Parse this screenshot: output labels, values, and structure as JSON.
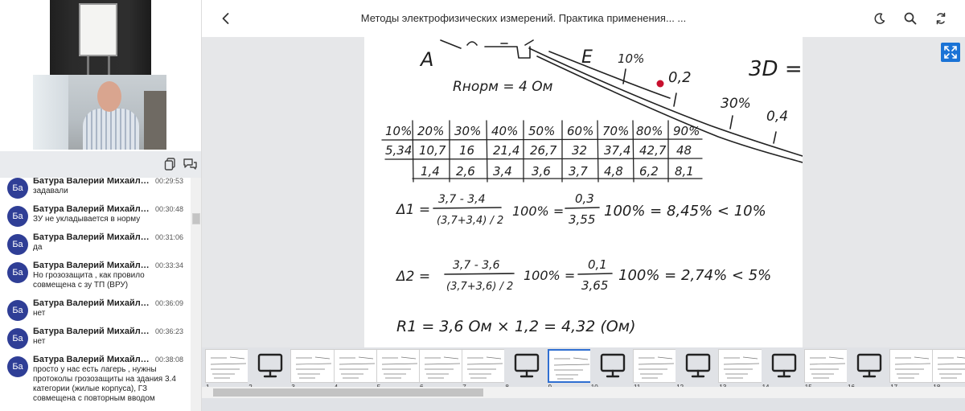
{
  "header": {
    "title": "Методы электрофизических измерений. Практика применения... ..."
  },
  "video": {
    "feeds": [
      "presenter-board",
      "presenter-camera"
    ]
  },
  "chat": {
    "messages": [
      {
        "initials": "Ба",
        "name": "Батура Валерий Михайлович",
        "time": "00:29:53",
        "text": "задавали"
      },
      {
        "initials": "Ба",
        "name": "Батура Валерий Михайлович",
        "time": "00:30:48",
        "text": "ЗУ не укладывается в норму"
      },
      {
        "initials": "Ба",
        "name": "Батура Валерий Михайлович",
        "time": "00:31:06",
        "text": "да"
      },
      {
        "initials": "Ба",
        "name": "Батура Валерий Михайлович",
        "time": "00:33:34",
        "text": "Но грозозащита , как провило совмещена с зу ТП (ВРУ)"
      },
      {
        "initials": "Ба",
        "name": "Батура Валерий Михайлович",
        "time": "00:36:09",
        "text": "нет"
      },
      {
        "initials": "Ба",
        "name": "Батура Валерий Михайлович",
        "time": "00:36:23",
        "text": "нет"
      },
      {
        "initials": "Ба",
        "name": "Батура Валерий Михайлович",
        "time": "00:38:08",
        "text": "просто у нас есть лагерь , нужны протоколы грозозащиты на здания 3.4 категории (жилые корпуса), ГЗ совмещена с повторным вводом"
      }
    ]
  },
  "slide": {
    "top_labels": [
      "A",
      "E",
      "10%",
      "0,2",
      "3D =",
      "30%",
      "0,4"
    ],
    "rnorm": "Rнорм = 4 Ом",
    "table_header": [
      "10%",
      "20%",
      "30%",
      "40%",
      "50%",
      "60%",
      "70%",
      "80%",
      "90%"
    ],
    "table_row1": [
      "5,34",
      "10,7",
      "16",
      "21,4",
      "26,7",
      "32",
      "37,4",
      "42,7",
      "48"
    ],
    "table_row2": [
      "",
      "1,4",
      "2,6",
      "3,4",
      "3,6",
      "3,7",
      "4,8",
      "6,2",
      "8,1"
    ],
    "formula1": {
      "label": "Δ1 =",
      "num": "3,7 - 3,4",
      "den": "(3,7+3,4) / 2",
      "mid": "100% =",
      "num2": "0,3",
      "den2": "3,55",
      "result": "100% = 8,45% < 10%"
    },
    "formula2": {
      "label": "Δ2 =",
      "num": "3,7 - 3,6",
      "den": "(3,7+3,6) / 2",
      "mid": "100% =",
      "num2": "0,1",
      "den2": "3,65",
      "result": "100% = 2,74% < 5%"
    },
    "formula3": "R1 = 3,6 Ом × 1,2 = 4,32 (Ом)"
  },
  "thumbnails": {
    "items": [
      {
        "num": "1",
        "kind": "slide"
      },
      {
        "num": "2",
        "kind": "monitor"
      },
      {
        "num": "3",
        "kind": "slide"
      },
      {
        "num": "4",
        "kind": "slide"
      },
      {
        "num": "5",
        "kind": "slide"
      },
      {
        "num": "6",
        "kind": "slide"
      },
      {
        "num": "7",
        "kind": "slide"
      },
      {
        "num": "8",
        "kind": "monitor"
      },
      {
        "num": "9",
        "kind": "slide",
        "active": true
      },
      {
        "num": "10",
        "kind": "monitor"
      },
      {
        "num": "11",
        "kind": "slide"
      },
      {
        "num": "12",
        "kind": "monitor"
      },
      {
        "num": "13",
        "kind": "slide"
      },
      {
        "num": "14",
        "kind": "monitor"
      },
      {
        "num": "15",
        "kind": "slide"
      },
      {
        "num": "16",
        "kind": "monitor"
      },
      {
        "num": "17",
        "kind": "slide"
      },
      {
        "num": "18",
        "kind": "slide"
      }
    ]
  },
  "colors": {
    "accent": "#1a73d6",
    "avatar": "#2f3e96",
    "pointer": "#c8102e"
  },
  "icons": {
    "back": "chevron-left-icon",
    "theme": "moon-icon",
    "search": "search-icon",
    "sync": "sync-icon",
    "expand": "expand-icon",
    "copy": "copy-icon",
    "chat": "chat-icon",
    "monitor": "monitor-icon"
  }
}
